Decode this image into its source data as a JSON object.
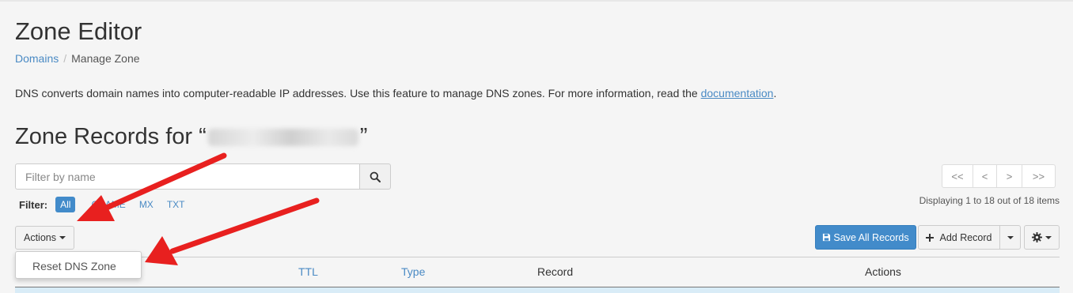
{
  "header": {
    "title": "Zone Editor",
    "breadcrumb": [
      {
        "label": "Domains"
      },
      {
        "separator": "/"
      },
      {
        "label": "Manage Zone"
      }
    ]
  },
  "description": {
    "text": "DNS converts domain names into computer-readable IP addresses. Use this feature to manage DNS zones. For more information, read the ",
    "link": "documentation",
    "end": "."
  },
  "zone": {
    "title_prefix": "Zone Records for “",
    "title_suffix": "”"
  },
  "search": {
    "placeholder": "Filter by name",
    "icon": "search-icon"
  },
  "filter": {
    "label": "Filter:",
    "options": [
      "All",
      "CNAME",
      "MX",
      "TXT"
    ],
    "active": "All"
  },
  "pagination": {
    "buttons": [
      "<<",
      "<",
      ">",
      ">>"
    ],
    "summary": "Displaying 1 to 18 out of 18 items"
  },
  "toolbar": {
    "actions_label": "Actions",
    "dropdown_item": "Reset DNS Zone",
    "save_all_label": "Save All Records",
    "save_icon": "floppy-disk-icon",
    "add_record_label": "Add Record",
    "add_icon": "plus-icon",
    "settings_icon": "gear-icon"
  },
  "table": {
    "headers": [
      "TTL",
      "Type",
      "Record",
      "Actions"
    ]
  },
  "colors": {
    "primary": "#428bca",
    "link": "#4a8ac4",
    "annotation_arrow": "#e8201f",
    "selected_row": "#d9ecf7"
  }
}
